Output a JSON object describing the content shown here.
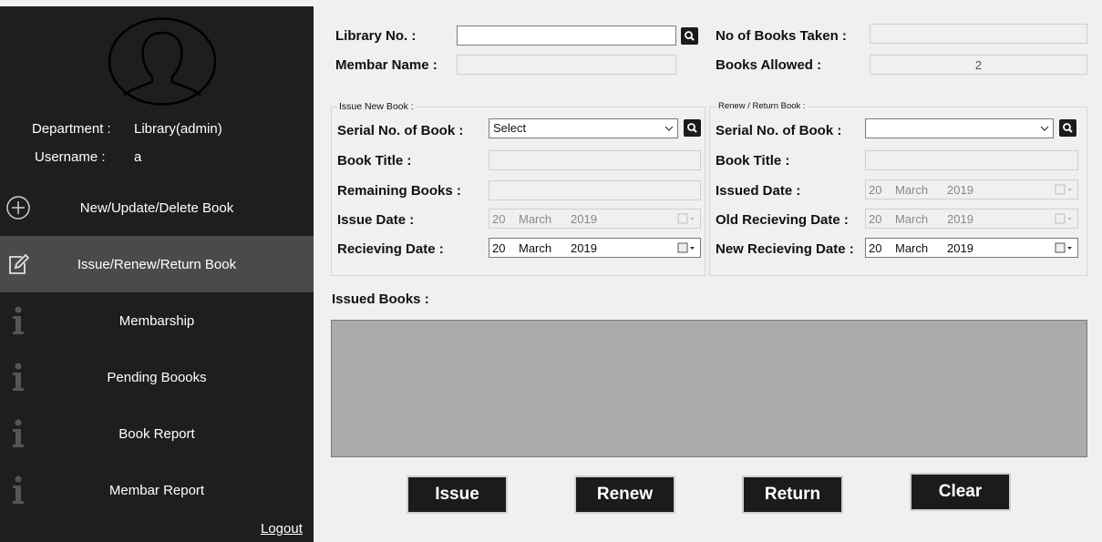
{
  "sidebar": {
    "department_label": "Department :",
    "department_value": "Library(admin)",
    "username_label": "Username :",
    "username_value": "a",
    "items": [
      {
        "label": "New/Update/Delete Book",
        "icon": "add-circle-icon"
      },
      {
        "label": "Issue/Renew/Return Book",
        "icon": "edit-icon"
      },
      {
        "label": "Membarship",
        "icon": "info-icon"
      },
      {
        "label": "Pending Boooks",
        "icon": "info-icon"
      },
      {
        "label": "Book Report",
        "icon": "info-icon"
      },
      {
        "label": "Membar Report",
        "icon": "info-icon"
      }
    ],
    "logout": "Logout"
  },
  "member": {
    "library_no_label": "Library No.  :",
    "library_no_value": "",
    "member_name_label": "Membar Name  :",
    "member_name_value": "",
    "books_taken_label": "No of Books Taken  :",
    "books_taken_value": "",
    "books_allowed_label": "Books Allowed  :",
    "books_allowed_value": "2"
  },
  "issue_group": {
    "title": "Issue New Book :",
    "serial_label": "Serial No. of Book  :",
    "serial_value": "Select",
    "title_label": "Book Title  :",
    "remaining_label": "Remaining Books  :",
    "issue_date_label": "Issue Date  :",
    "issue_date": {
      "day": "20",
      "month": "March",
      "year": "2019"
    },
    "receiving_date_label": "Recieving Date  :",
    "receiving_date": {
      "day": "20",
      "month": "March",
      "year": "2019"
    }
  },
  "renew_group": {
    "title": "Renew / Return Book :",
    "serial_label": "Serial No. of Book  :",
    "serial_value": "",
    "title_label": "Book Title  :",
    "issued_date_label": "Issued Date  :",
    "issued_date": {
      "day": "20",
      "month": "March",
      "year": "2019"
    },
    "old_date_label": "Old Recieving Date  :",
    "old_date": {
      "day": "20",
      "month": "March",
      "year": "2019"
    },
    "new_date_label": "New Recieving Date :",
    "new_date": {
      "day": "20",
      "month": "March",
      "year": "2019"
    }
  },
  "issued_books_label": "Issued Books :",
  "actions": {
    "issue": "Issue",
    "renew": "Renew",
    "return": "Return",
    "clear": "Clear"
  },
  "colors": {
    "sidebar_bg": "#1e1e1e",
    "sidebar_active": "#4a4a4a",
    "button_bg": "#1b1b1b",
    "grid_bg": "#ababab"
  }
}
